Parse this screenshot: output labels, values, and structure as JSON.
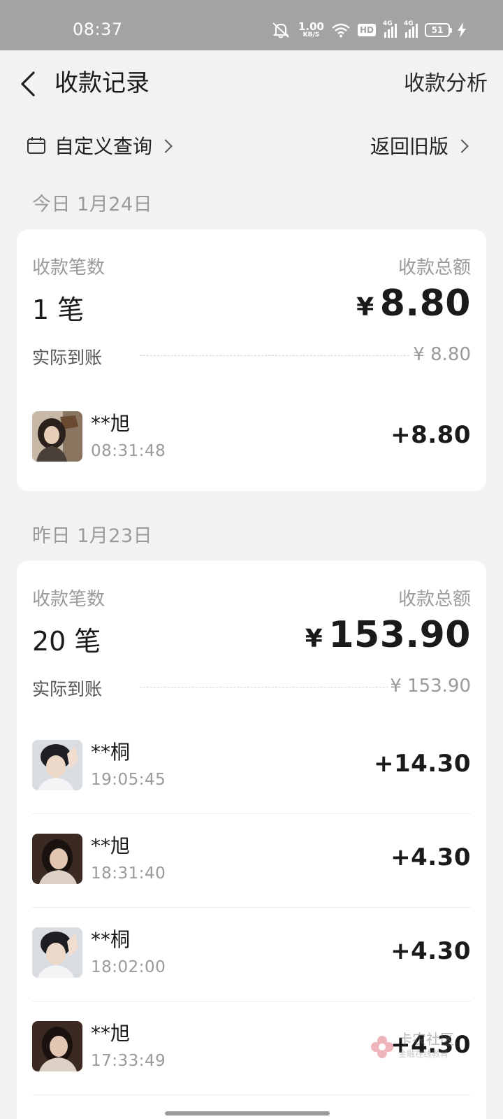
{
  "status_bar": {
    "time": "08:37",
    "net_speed_value": "1.00",
    "net_speed_unit": "KB/S",
    "hd_label": "HD",
    "sim1_label": "4G",
    "sim2_label": "4G",
    "battery_level": "51",
    "icons": [
      "mute-icon",
      "wifi-icon",
      "signal-icon",
      "battery-icon",
      "charging-icon"
    ]
  },
  "header": {
    "title": "收款记录",
    "analysis_label": "收款分析",
    "back_icon": "chevron-left-icon"
  },
  "query_row": {
    "custom_query_label": "自定义查询",
    "old_version_label": "返回旧版",
    "calendar_icon": "calendar-icon"
  },
  "days": [
    {
      "date_label": "今日 1月24日",
      "count_label": "收款笔数",
      "count_value": "1 笔",
      "total_label": "收款总额",
      "total_currency": "¥",
      "total_value": "8.80",
      "settled_label": "实际到账",
      "settled_value": "¥ 8.80",
      "transactions": [
        {
          "name": "**旭",
          "time": "08:31:48",
          "amount": "+8.80"
        }
      ]
    },
    {
      "date_label": "昨日 1月23日",
      "count_label": "收款笔数",
      "count_value": "20 笔",
      "total_label": "收款总额",
      "total_currency": "¥",
      "total_value": "153.90",
      "settled_label": "实际到账",
      "settled_value": "¥ 153.90",
      "transactions": [
        {
          "name": "**桐",
          "time": "19:05:45",
          "amount": "+14.30"
        },
        {
          "name": "**旭",
          "time": "18:31:40",
          "amount": "+4.30"
        },
        {
          "name": "**桐",
          "time": "18:02:00",
          "amount": "+4.30"
        },
        {
          "name": "**旭",
          "time": "17:33:49",
          "amount": "+4.30"
        }
      ]
    }
  ],
  "watermark": {
    "line1": "卡农社区",
    "line2": "金融在线教育"
  },
  "colors": {
    "background": "#f2f2f2",
    "card": "#ffffff",
    "status_bar": "#a3a3a3",
    "muted_text": "#9a9a9a",
    "primary_text": "#1a1a1a"
  }
}
